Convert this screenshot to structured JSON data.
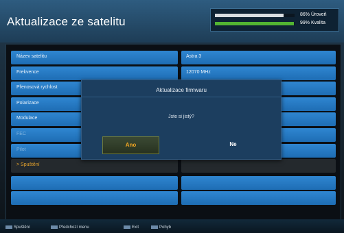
{
  "header": {
    "title": "Aktualizace ze satelitu"
  },
  "signal": [
    {
      "percent": 86,
      "text": "86% Úroveň",
      "color": "#d9dde0"
    },
    {
      "percent": 99,
      "text": "99% Kvalita",
      "color": "#52b432"
    }
  ],
  "settings": {
    "rows": [
      {
        "label": "Název satelitu",
        "value": "Astra 3",
        "state": "normal"
      },
      {
        "label": "Frekvence",
        "value": "12070 MHz",
        "state": "normal"
      },
      {
        "label": "Přenosová rychlost",
        "value": "",
        "state": "normal"
      },
      {
        "label": "Polarizace",
        "value": "",
        "state": "normal"
      },
      {
        "label": "Modulace",
        "value": "",
        "state": "normal"
      },
      {
        "label": "FEC",
        "value": "",
        "state": "disabled"
      },
      {
        "label": "Pilot",
        "value": "",
        "state": "disabled"
      },
      {
        "label": "> Spuštění",
        "value": "",
        "state": "selected"
      }
    ]
  },
  "dialog": {
    "title": "Aktualizace firmwaru",
    "message": "Jste si jistý?",
    "yes_label": "Ano",
    "no_label": "Ne"
  },
  "footer": {
    "items": [
      "Spuštění",
      "Předchozí menu",
      "Exit",
      "Pohyb"
    ]
  }
}
